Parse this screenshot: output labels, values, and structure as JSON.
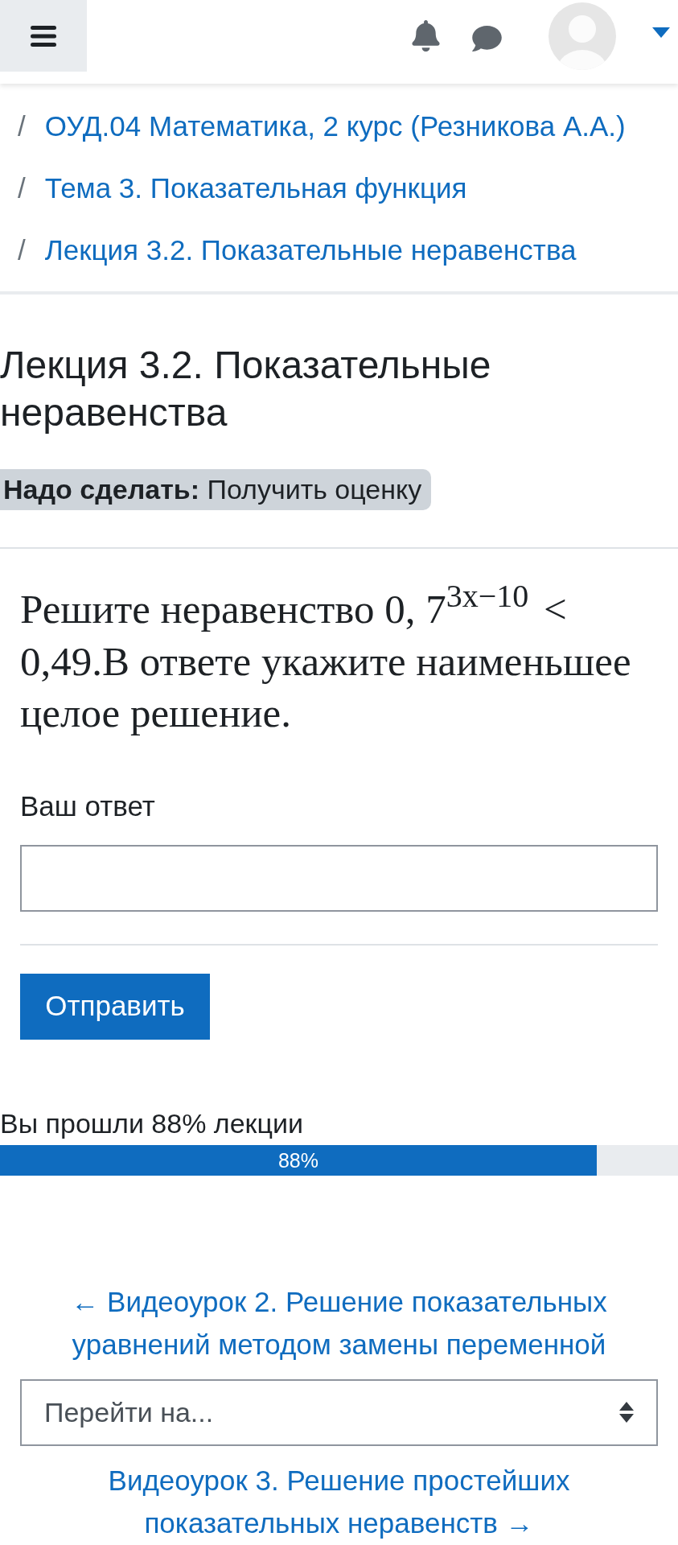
{
  "breadcrumbs": [
    {
      "separator": "/",
      "label": "ОУД.04 Математика, 2 курс (Резникова А.А.)"
    },
    {
      "separator": "/",
      "label": "Тема 3. Показательная функция"
    },
    {
      "separator": "/",
      "label": "Лекция 3.2. Показательные неравенства"
    }
  ],
  "page_title": "Лекция 3.2. Показательные неравенства",
  "completion_badge": "**Надо сделать:** Получить оценку",
  "question": {
    "text": "Решите неравенство 0, 7$^{3x−10}$ < 0,49.В ответе укажите наименьшее целое решение.",
    "answer_label": "Ваш ответ",
    "submit_button": "Отправить"
  },
  "progress": {
    "label": "Вы прошли 88% лекции",
    "level": 0.88,
    "bar_text": "88%"
  },
  "navigation": {
    "previous_link": "← Видеоурок 2. Решение показательных уравнений методом замены переменной",
    "jump_select": {
      "value": "Перейти на..."
    },
    "next_link": "Видеоурок 3. Решение простейших показательных неравенств →"
  }
}
